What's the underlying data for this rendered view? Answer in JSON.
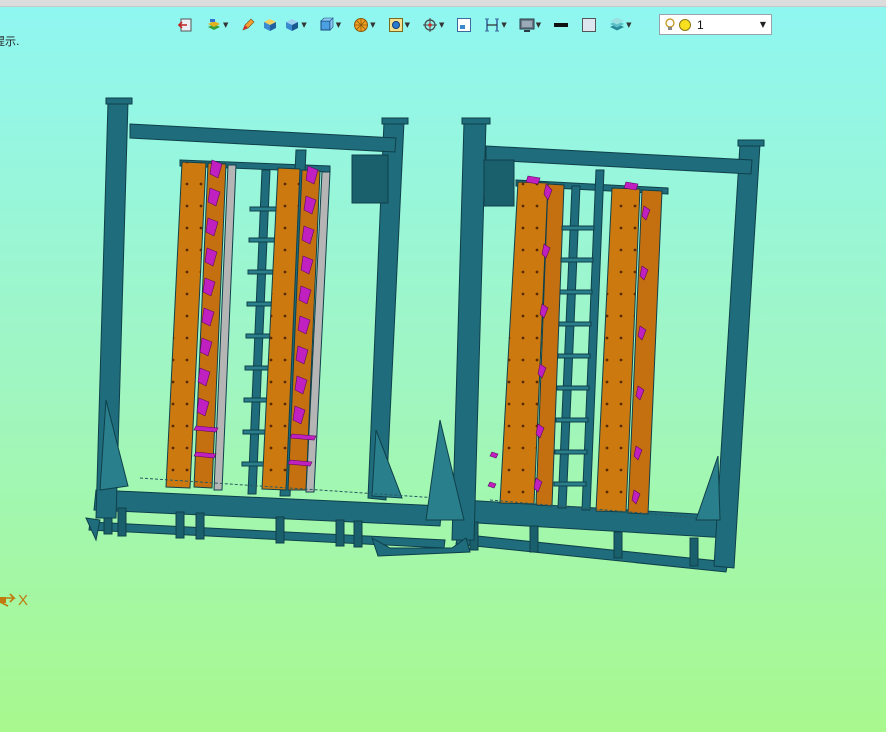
{
  "toolbar": {
    "items": [
      {
        "icon": "exit-sketch-icon"
      },
      {
        "icon": "layer-stack-icon",
        "dropdown": true
      },
      {
        "icon": "pencil-icon"
      },
      {
        "icon": "shaded-box-icon"
      },
      {
        "icon": "solid-box-icon",
        "dropdown": true
      },
      {
        "icon": "view-cube-icon",
        "dropdown": true
      },
      {
        "icon": "filter-icon",
        "dropdown": true
      },
      {
        "icon": "snap-icon",
        "dropdown": true
      },
      {
        "icon": "orient-icon",
        "dropdown": true
      },
      {
        "icon": "window-icon"
      },
      {
        "icon": "section-icon",
        "dropdown": true
      },
      {
        "icon": "display-mode-icon",
        "dropdown": true
      },
      {
        "icon": "line-color-icon"
      },
      {
        "icon": "fill-color-icon"
      },
      {
        "icon": "layers-icon",
        "dropdown": true
      }
    ],
    "layer_value": "1"
  },
  "hint_text": "提示.",
  "axis_label": "X",
  "colors": {
    "frame": "#1f6d7c",
    "frame_dark": "#0f3f4a",
    "panel": "#cc7a10",
    "clamp": "#c020c0",
    "bg_top": "#8ff6f2",
    "bg_bottom": "#a8f88e"
  }
}
